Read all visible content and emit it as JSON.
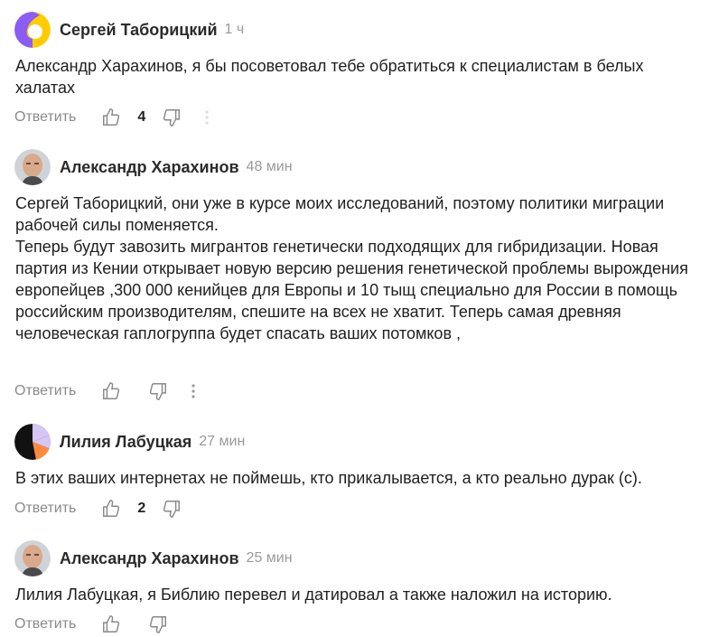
{
  "comments": [
    {
      "author": "Сергей Таборицкий",
      "time": "1 ч",
      "avatar": "yellow-purple-avatar",
      "text": [
        "Александр Харахинов, я бы посоветовал тебе обратиться к специалистам в белых халатах"
      ],
      "reply_label": "Ответить",
      "likes": "4"
    },
    {
      "author": "Александр Харахинов",
      "time": "48 мин",
      "avatar": "user-photo-avatar",
      "text": [
        "Сергей Таборицкий, они уже в курсе моих исследований, поэтому политики миграции рабочей силы поменяется.",
        "Теперь будут завозить мигрантов генетически подходящих для гибридизации. Новая партия из Кении открывает новую версию решения генетической проблемы вырождения европейцев ,300 000 кенийцев для Европы и 10 тыщ специально для России в помощь российским производителям, спешите на всех не хватит. Теперь самая древняя человеческая гаплогруппа будет спасать ваших потомков ,"
      ],
      "reply_label": "Ответить",
      "likes": ""
    },
    {
      "author": "Лилия Лабуцкая",
      "time": "27 мин",
      "avatar": "black-orange-avatar",
      "text": [
        "В этих ваших интернетах не поймешь, кто прикалывается, а кто реально дурак (с)."
      ],
      "reply_label": "Ответить",
      "likes": "2"
    },
    {
      "author": "Александр Харахинов",
      "time": "25 мин",
      "avatar": "user-photo-avatar",
      "text": [
        "Лилия Лабуцкая, я Библию перевел и датировал а также наложил на историю."
      ],
      "reply_label": "Ответить",
      "likes": ""
    }
  ],
  "colors": {
    "text": "#1f1f1f",
    "muted": "#8a8a8a",
    "avatar_yellow": "#ffcc00",
    "avatar_purple": "#8b5cf6",
    "avatar_orange": "#ff8a3d",
    "avatar_black": "#111111"
  }
}
